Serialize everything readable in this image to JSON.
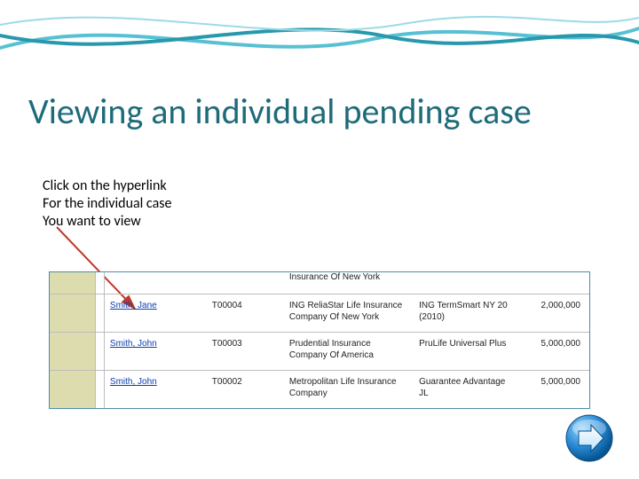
{
  "slide": {
    "title": "Viewing an individual pending case",
    "instruction_lines": [
      "Click on the hyperlink",
      "For the individual case",
      "You want to view"
    ]
  },
  "table": {
    "top_clip": {
      "insurer": "Insurance Of New York",
      "product": "",
      "amount": ""
    },
    "rows": [
      {
        "name": "Smith, Jane",
        "id": "T00004",
        "insurer": "ING ReliaStar Life Insurance Company Of New York",
        "product": "ING TermSmart NY 20 (2010)",
        "amount": "2,000,000"
      },
      {
        "name": "Smith, John",
        "id": "T00003",
        "insurer": "Prudential Insurance Company Of America",
        "product": "PruLife Universal Plus",
        "amount": "5,000,000"
      },
      {
        "name": "Smith, John",
        "id": "T00002",
        "insurer": "Metropolitan Life Insurance Company",
        "product": "Guarantee Advantage JL",
        "amount": "5,000,000"
      }
    ]
  },
  "nav": {
    "next_label": "Next"
  }
}
